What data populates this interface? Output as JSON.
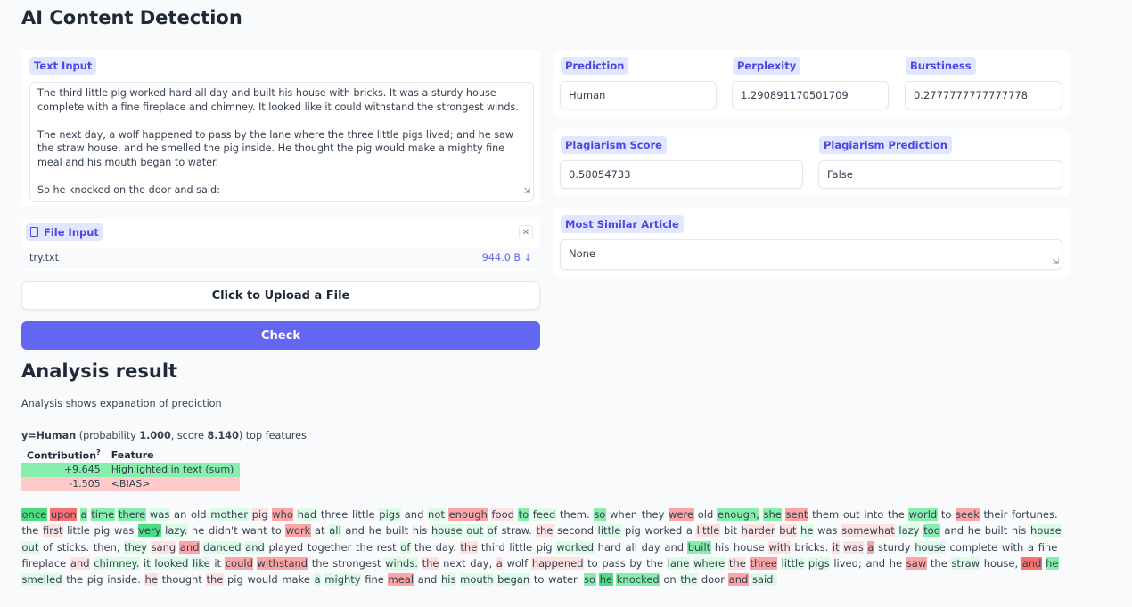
{
  "page": {
    "title": "AI Content Detection"
  },
  "text_input": {
    "label": "Text Input",
    "paragraphs": [
      "The third little pig worked hard all day and built his house with bricks. It was a sturdy house complete with a fine fireplace and chimney. It looked like it could withstand the strongest winds.",
      "The next day, a wolf happened to pass by the lane where the three little pigs lived; and he saw the straw house, and he smelled the pig inside. He thought the pig would make a mighty fine meal and his mouth began to water.",
      "So he knocked on the door and said:"
    ]
  },
  "file_input": {
    "label": "File Input",
    "filename": "try.txt",
    "size": "944.0 B ↓"
  },
  "buttons": {
    "upload": "Click to Upload a File",
    "check": "Check"
  },
  "results": {
    "prediction": {
      "label": "Prediction",
      "value": "Human"
    },
    "perplexity": {
      "label": "Perplexity",
      "value": "1.290891170501709"
    },
    "burstiness": {
      "label": "Burstiness",
      "value": "0.2777777777777778"
    },
    "plagiarism_score": {
      "label": "Plagiarism Score",
      "value": "0.58054733"
    },
    "plagiarism_prediction": {
      "label": "Plagiarism Prediction",
      "value": "False"
    },
    "most_similar": {
      "label": "Most Similar Article",
      "value": "None"
    }
  },
  "analysis": {
    "heading": "Analysis result",
    "description": "Analysis shows expanation of prediction",
    "y_label": "y=Human",
    "prob_prefix": " (probability ",
    "probability": "1.000",
    "score_prefix": ", score ",
    "score": "8.140",
    "suffix": ") top features",
    "table_headers": {
      "contribution": "Contribution",
      "sup": "?",
      "feature": "Feature"
    },
    "table_rows": [
      {
        "contribution": "+9.645",
        "feature": "Highlighted in text (sum)",
        "color": "#86efac"
      },
      {
        "contribution": "-1.505",
        "feature": "<BIAS>",
        "color": "#fecaca"
      }
    ],
    "colors": {
      "pos_strong": "#4ade80",
      "pos_mid": "#86efac",
      "pos_weak": "#dcfce7",
      "neg_strong": "#f87171",
      "neg_mid": "#fca5a5",
      "neg_weak": "#fee2e2"
    },
    "tokens": [
      [
        "once",
        "G3"
      ],
      [
        "upon",
        "R3"
      ],
      [
        "a",
        "G2"
      ],
      [
        "time",
        "G2"
      ],
      [
        "there",
        "G2"
      ],
      [
        "was",
        "G1"
      ],
      [
        "an",
        ""
      ],
      [
        "old",
        ""
      ],
      [
        "mother",
        "G1"
      ],
      [
        "pig",
        "R1"
      ],
      [
        "who",
        "R2"
      ],
      [
        "had",
        "G1"
      ],
      [
        "three",
        ""
      ],
      [
        "little",
        ""
      ],
      [
        "pigs",
        "G1"
      ],
      [
        "and",
        ""
      ],
      [
        "not",
        "G1"
      ],
      [
        "enough",
        "R2"
      ],
      [
        "food",
        "R1"
      ],
      [
        "to",
        "G2"
      ],
      [
        "feed",
        "G1"
      ],
      [
        "them.",
        ""
      ],
      [
        "so",
        "G2"
      ],
      [
        "when",
        ""
      ],
      [
        "they",
        ""
      ],
      [
        "were",
        "R2"
      ],
      [
        "old",
        ""
      ],
      [
        "enough,",
        "G2"
      ],
      [
        "she",
        "G2"
      ],
      [
        "sent",
        "R2"
      ],
      [
        "them",
        ""
      ],
      [
        "out",
        ""
      ],
      [
        "into",
        ""
      ],
      [
        "the",
        ""
      ],
      [
        "world",
        "G2"
      ],
      [
        "to",
        ""
      ],
      [
        "seek",
        "R2"
      ],
      [
        "their",
        ""
      ],
      [
        "fortunes.",
        ""
      ],
      [
        "the",
        ""
      ],
      [
        "first",
        "R1"
      ],
      [
        "little",
        ""
      ],
      [
        "pig",
        ""
      ],
      [
        "was",
        ""
      ],
      [
        "very",
        "G3"
      ],
      [
        "lazy.",
        "G1"
      ],
      [
        "he",
        ""
      ],
      [
        "didn't",
        ""
      ],
      [
        "want",
        ""
      ],
      [
        "to",
        ""
      ],
      [
        "work",
        "R2"
      ],
      [
        "at",
        ""
      ],
      [
        "all",
        "G1"
      ],
      [
        "and",
        ""
      ],
      [
        "he",
        ""
      ],
      [
        "built",
        ""
      ],
      [
        "his",
        ""
      ],
      [
        "house",
        "G1"
      ],
      [
        "out",
        "G1"
      ],
      [
        "of",
        "G1"
      ],
      [
        "straw.",
        ""
      ],
      [
        "the",
        "R1"
      ],
      [
        "second",
        ""
      ],
      [
        "little",
        "G1"
      ],
      [
        "pig",
        ""
      ],
      [
        "worked",
        ""
      ],
      [
        "a",
        ""
      ],
      [
        "little",
        "R1"
      ],
      [
        "bit",
        ""
      ],
      [
        "harder",
        "R1"
      ],
      [
        "but",
        "R1"
      ],
      [
        "he",
        "G1"
      ],
      [
        "was",
        ""
      ],
      [
        "somewhat",
        "R1"
      ],
      [
        "lazy",
        "G1"
      ],
      [
        "too",
        "G2"
      ],
      [
        "and",
        ""
      ],
      [
        "he",
        ""
      ],
      [
        "built",
        ""
      ],
      [
        "his",
        ""
      ],
      [
        "house",
        "G1"
      ],
      [
        "out",
        "G1"
      ],
      [
        "of",
        ""
      ],
      [
        "sticks.",
        ""
      ],
      [
        "then,",
        ""
      ],
      [
        "they",
        "G1"
      ],
      [
        "sang",
        "R1"
      ],
      [
        "and",
        "R2"
      ],
      [
        "danced",
        "G1"
      ],
      [
        "and",
        "G1"
      ],
      [
        "played",
        ""
      ],
      [
        "together",
        ""
      ],
      [
        "the",
        ""
      ],
      [
        "rest",
        ""
      ],
      [
        "of",
        "G1"
      ],
      [
        "the",
        ""
      ],
      [
        "day.",
        ""
      ],
      [
        "the",
        "R1"
      ],
      [
        "third",
        ""
      ],
      [
        "little",
        ""
      ],
      [
        "pig",
        ""
      ],
      [
        "worked",
        "G1"
      ],
      [
        "hard",
        ""
      ],
      [
        "all",
        ""
      ],
      [
        "day",
        ""
      ],
      [
        "and",
        ""
      ],
      [
        "built",
        "G2"
      ],
      [
        "his",
        ""
      ],
      [
        "house",
        ""
      ],
      [
        "with",
        "R1"
      ],
      [
        "bricks.",
        ""
      ],
      [
        "it",
        "R1"
      ],
      [
        "was",
        "R1"
      ],
      [
        "a",
        "R2"
      ],
      [
        "sturdy",
        ""
      ],
      [
        "house",
        "G1"
      ],
      [
        "complete",
        ""
      ],
      [
        "with",
        ""
      ],
      [
        "a",
        ""
      ],
      [
        "fine",
        ""
      ],
      [
        "fireplace",
        ""
      ],
      [
        "and",
        "R1"
      ],
      [
        "chimney.",
        "G1"
      ],
      [
        "it",
        "G1"
      ],
      [
        "looked",
        "G1"
      ],
      [
        "like",
        "G1"
      ],
      [
        "it",
        ""
      ],
      [
        "could",
        "R2"
      ],
      [
        "withstand",
        "R2"
      ],
      [
        "the",
        ""
      ],
      [
        "strongest",
        ""
      ],
      [
        "winds.",
        "G1"
      ],
      [
        "the",
        "R1"
      ],
      [
        "next",
        ""
      ],
      [
        "day,",
        ""
      ],
      [
        "a",
        "R1"
      ],
      [
        "wolf",
        ""
      ],
      [
        "happened",
        "R1"
      ],
      [
        "to",
        ""
      ],
      [
        "pass",
        ""
      ],
      [
        "by",
        ""
      ],
      [
        "the",
        ""
      ],
      [
        "lane",
        "G1"
      ],
      [
        "where",
        "G1"
      ],
      [
        "the",
        "R1"
      ],
      [
        "three",
        "R2"
      ],
      [
        "little",
        "G1"
      ],
      [
        "pigs",
        "G1"
      ],
      [
        "lived;",
        ""
      ],
      [
        "and",
        ""
      ],
      [
        "he",
        ""
      ],
      [
        "saw",
        "R2"
      ],
      [
        "the",
        ""
      ],
      [
        "straw",
        "G1"
      ],
      [
        "house,",
        ""
      ],
      [
        "and",
        "R3"
      ],
      [
        "he",
        "G2"
      ],
      [
        "smelled",
        "G1"
      ],
      [
        "the",
        ""
      ],
      [
        "pig",
        ""
      ],
      [
        "inside.",
        ""
      ],
      [
        "he",
        "R1"
      ],
      [
        "thought",
        ""
      ],
      [
        "the",
        "R1"
      ],
      [
        "pig",
        ""
      ],
      [
        "would",
        ""
      ],
      [
        "make",
        ""
      ],
      [
        "a",
        "G1"
      ],
      [
        "mighty",
        "G1"
      ],
      [
        "fine",
        ""
      ],
      [
        "meal",
        "R2"
      ],
      [
        "and",
        ""
      ],
      [
        "his",
        "G1"
      ],
      [
        "mouth",
        "G1"
      ],
      [
        "began",
        "G1"
      ],
      [
        "to",
        ""
      ],
      [
        "water.",
        ""
      ],
      [
        "so",
        "G2"
      ],
      [
        "he",
        "G3"
      ],
      [
        "knocked",
        "G2"
      ],
      [
        "on",
        ""
      ],
      [
        "the",
        "G1"
      ],
      [
        "door",
        ""
      ],
      [
        "and",
        "R2"
      ],
      [
        "said:",
        "G1"
      ]
    ]
  }
}
